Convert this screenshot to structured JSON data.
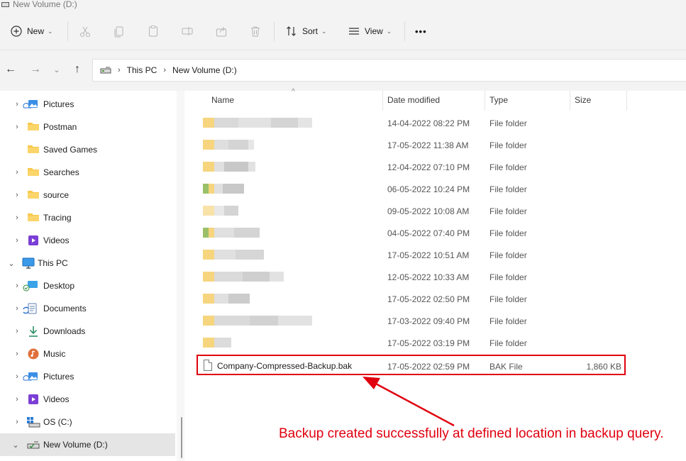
{
  "window": {
    "title": "New Volume (D:)"
  },
  "toolbar": {
    "new_label": "New",
    "sort_label": "Sort",
    "view_label": "View",
    "more_label": "•••"
  },
  "address": {
    "crumbs": [
      "This PC",
      "New Volume (D:)"
    ]
  },
  "sidebar": {
    "items": [
      {
        "label": "Pictures",
        "icon": "pictures-icon"
      },
      {
        "label": "Postman",
        "icon": "folder-icon"
      },
      {
        "label": "Saved Games",
        "icon": "folder-icon"
      },
      {
        "label": "Searches",
        "icon": "folder-icon"
      },
      {
        "label": "source",
        "icon": "folder-icon"
      },
      {
        "label": "Tracing",
        "icon": "folder-icon"
      },
      {
        "label": "Videos",
        "icon": "videos-icon"
      },
      {
        "label": "This PC",
        "icon": "monitor-icon"
      },
      {
        "label": "Desktop",
        "icon": "desktop-icon"
      },
      {
        "label": "Documents",
        "icon": "documents-icon"
      },
      {
        "label": "Downloads",
        "icon": "download-icon"
      },
      {
        "label": "Music",
        "icon": "music-icon"
      },
      {
        "label": "Pictures",
        "icon": "pictures-icon"
      },
      {
        "label": "Videos",
        "icon": "videos-icon"
      },
      {
        "label": "OS (C:)",
        "icon": "drive-icon"
      },
      {
        "label": "New Volume (D:)",
        "icon": "drive-icon"
      }
    ]
  },
  "columns": {
    "name": "Name",
    "date": "Date modified",
    "type": "Type",
    "size": "Size"
  },
  "rows": [
    {
      "date": "14-04-2022 08:22 PM",
      "type": "File folder"
    },
    {
      "date": "17-05-2022 11:38 AM",
      "type": "File folder"
    },
    {
      "date": "12-04-2022 07:10 PM",
      "type": "File folder"
    },
    {
      "date": "06-05-2022 10:24 PM",
      "type": "File folder"
    },
    {
      "date": "09-05-2022 10:08 AM",
      "type": "File folder"
    },
    {
      "date": "04-05-2022 07:40 PM",
      "type": "File folder"
    },
    {
      "date": "17-05-2022 10:51 AM",
      "type": "File folder"
    },
    {
      "date": "12-05-2022 10:33 AM",
      "type": "File folder"
    },
    {
      "date": "17-05-2022 02:50 PM",
      "type": "File folder"
    },
    {
      "date": "17-03-2022 09:40 PM",
      "type": "File folder"
    },
    {
      "date": "17-05-2022 03:19 PM",
      "type": "File folder"
    }
  ],
  "backup_file": {
    "name": "Company-Compressed-Backup.bak",
    "date": "17-05-2022 02:59 PM",
    "type": "BAK File",
    "size": "1,860 KB"
  },
  "annotation": {
    "text": "Backup created successfully at defined location in backup query.",
    "color": "#e0000f"
  },
  "colors": {
    "folder": "#f8c84a",
    "highlight": "#e0000f",
    "selected_nav": "#e5e5e5"
  }
}
